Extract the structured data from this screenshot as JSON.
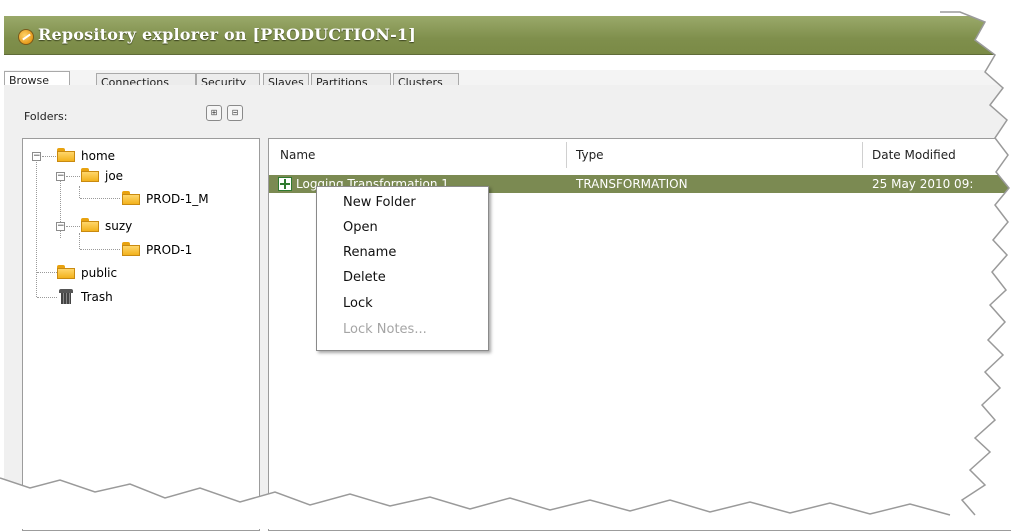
{
  "window": {
    "title": "Repository explorer on [PRODUCTION-1]"
  },
  "tabs": [
    {
      "label": "Browse",
      "active": true
    },
    {
      "label": "Connections",
      "active": false
    },
    {
      "label": "Security",
      "active": false
    },
    {
      "label": "Slaves",
      "active": false
    },
    {
      "label": "Partitions",
      "active": false
    },
    {
      "label": "Clusters",
      "active": false
    }
  ],
  "folders_panel": {
    "label": "Folders:",
    "tree": [
      {
        "label": "home",
        "icon": "folder-icon",
        "expander": "minus"
      },
      {
        "label": "joe",
        "icon": "folder-icon",
        "expander": "minus"
      },
      {
        "label": "PROD-1_M",
        "icon": "folder-icon"
      },
      {
        "label": "suzy",
        "icon": "folder-icon",
        "expander": "minus"
      },
      {
        "label": "PROD-1",
        "icon": "folder-icon"
      },
      {
        "label": "public",
        "icon": "folder-icon"
      },
      {
        "label": "Trash",
        "icon": "trash-icon"
      }
    ]
  },
  "file_list": {
    "columns": [
      "Name",
      "Type",
      "Date Modified"
    ],
    "rows": [
      {
        "name": "Logging Transformation 1",
        "type": "TRANSFORMATION",
        "date": "25 May 2010 09:"
      }
    ]
  },
  "context_menu": {
    "items": [
      {
        "label": "New Folder",
        "enabled": true
      },
      {
        "label": "Open",
        "enabled": true
      },
      {
        "label": "Rename",
        "enabled": true
      },
      {
        "label": "Delete",
        "enabled": true
      },
      {
        "label": "Lock",
        "enabled": true
      },
      {
        "label": "Lock Notes...",
        "enabled": false
      }
    ]
  },
  "colors": {
    "titlebar": "#7f8f4c",
    "selection": "#7b8a52",
    "folder": "#f2b21d"
  }
}
